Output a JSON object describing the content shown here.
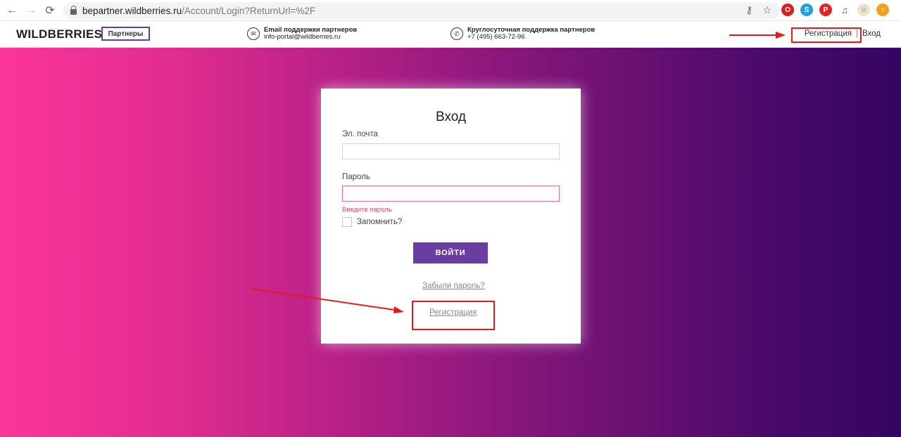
{
  "browser": {
    "url_host": "bepartner.wildberries.ru",
    "url_path": "/Account/Login?ReturnUrl=%2F",
    "extensions": [
      "opera-icon",
      "skype-icon",
      "pinterest-icon",
      "playlist-icon",
      "avatar-icon",
      "upload-icon"
    ]
  },
  "header": {
    "logo": "WILDBERRIES",
    "partners_label": "Партнеры",
    "email_support_title": "Email поддержки партнеров",
    "email_support_value": "info-portal@wildberries.ru",
    "phone_support_title": "Круглосуточная поддержка партнеров",
    "phone_support_value": "+7 (495) 663-72-96",
    "register_link": "Регистрация",
    "separator": "|",
    "login_link": "Вход"
  },
  "login_form": {
    "title": "Вход",
    "email_label": "Эл. почта",
    "email_value": "",
    "password_label": "Пароль",
    "password_value": "",
    "password_error": "Введите пароль",
    "remember_label": "Запомнить?",
    "submit_label": "ВОЙТИ",
    "forgot_link": "Забыли пароль?",
    "register_link": "Регистрация"
  },
  "colors": {
    "accent": "#6a3ea1",
    "gradient_start": "#fc3599",
    "gradient_end": "#340563",
    "annotation": "#e41b1b",
    "error": "#e8426f"
  }
}
